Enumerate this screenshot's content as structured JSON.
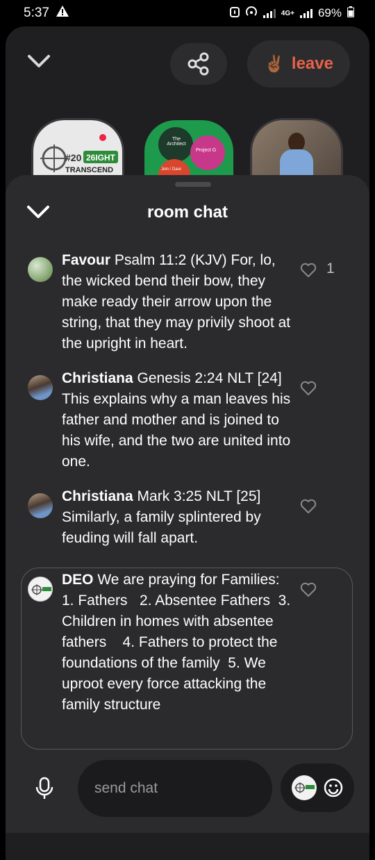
{
  "status": {
    "time": "5:37",
    "network": "4G+",
    "battery": "69%"
  },
  "header": {
    "leave_label": "leave",
    "leave_emoji": "✌🏾",
    "share_icon": "share-icon",
    "collapse_icon": "chevron-down-icon"
  },
  "speakers": [
    {
      "logo_text_1": "#20",
      "logo_text_2": "26IGHT",
      "logo_text_3": "TRANSCEND"
    },
    {
      "logo_text_1": "The Architect",
      "logo_text_2": "Project G",
      "logo_text_3": "Join / Dare"
    },
    {}
  ],
  "chat": {
    "title": "room chat",
    "messages": [
      {
        "name": "Favour",
        "text": " Psalm 11:2 (KJV) For, lo, the wicked bend their bow, they make ready their arrow upon the string, that they may privily shoot at the upright in heart.",
        "likes": "1"
      },
      {
        "name": "Christiana",
        "text": " Genesis 2:24 NLT [24] This explains why a man leaves his father and mother and is joined to his wife, and the two are united into one.",
        "likes": ""
      },
      {
        "name": "Christiana",
        "text": " Mark 3:25 NLT [25] Similarly, a family splintered by feuding will fall apart.",
        "likes": ""
      },
      {
        "name": "DEO",
        "text": " We are praying for Families:   1. Fathers   2. Absentee Fathers  3. Children in homes with absentee fathers    4. Fathers to protect the foundations of the family  5. We uproot every force attacking the family structure",
        "likes": ""
      }
    ],
    "input_placeholder": "send chat"
  },
  "colors": {
    "accent": "#e8624a",
    "sheet": "#2b2b2d",
    "background": "#1f1f21"
  }
}
